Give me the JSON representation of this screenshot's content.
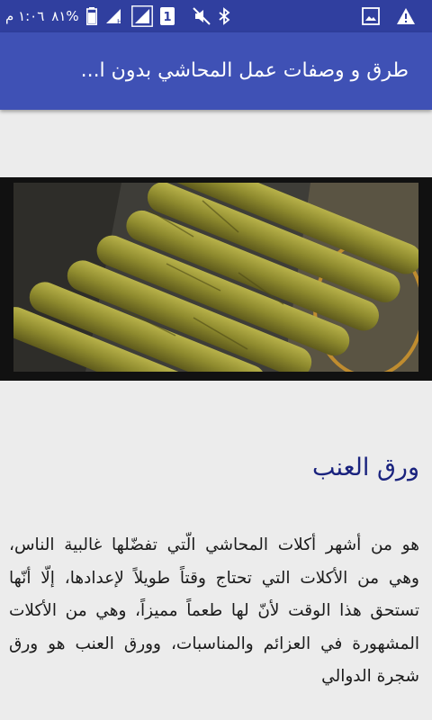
{
  "status_bar": {
    "time": "١:٠٦ م",
    "battery": "%٨١",
    "sim_badge": "1"
  },
  "app_bar": {
    "title": "طرق و وصفات عمل المحاشي بدون ا..."
  },
  "article": {
    "heading": "ورق العنب",
    "body": "هو من أشهر أكلات المحاشي الّتي تفضّلها غالبية الناس، وهي من الأكلات التي تحتاج وقتاً طويلاً لإعدادها، إلّا أنّها تستحق هذا الوقت لأنّ لها طعماً مميزاً، وهي من الأكلات المشهورة في العزائم والمناسبات، وورق العنب هو ورق شجرة الدوالي"
  },
  "colors": {
    "status_bar": "#303f9f",
    "app_bar": "#3f51b5",
    "heading": "#1a237e"
  }
}
